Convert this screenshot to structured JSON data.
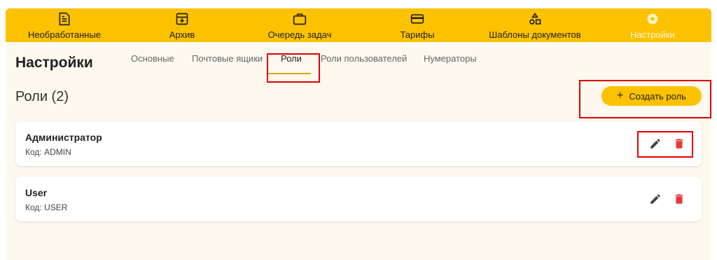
{
  "nav": {
    "items": [
      {
        "label": "Необработанные",
        "icon": "document-icon"
      },
      {
        "label": "Архив",
        "icon": "archive-icon"
      },
      {
        "label": "Очередь задач",
        "icon": "briefcase-icon"
      },
      {
        "label": "Тарифы",
        "icon": "credit-card-icon"
      },
      {
        "label": "Шаблоны документов",
        "icon": "shapes-icon"
      },
      {
        "label": "Настройки",
        "icon": "gear-icon",
        "active": true
      }
    ]
  },
  "page": {
    "title": "Настройки"
  },
  "tabs": [
    {
      "label": "Основные"
    },
    {
      "label": "Почтовые ящики"
    },
    {
      "label": "Роли",
      "active": true
    },
    {
      "label": "Роли пользователей"
    },
    {
      "label": "Нумераторы"
    }
  ],
  "roles": {
    "section_title": "Роли (2)",
    "create_button": "Создать роль",
    "items": [
      {
        "name": "Администратор",
        "code": "Код: ADMIN"
      },
      {
        "name": "User",
        "code": "Код: USER"
      }
    ]
  },
  "colors": {
    "accent": "#fcc200",
    "background": "#fdf9ef",
    "delete": "#e53935",
    "highlight": "#e10000"
  }
}
